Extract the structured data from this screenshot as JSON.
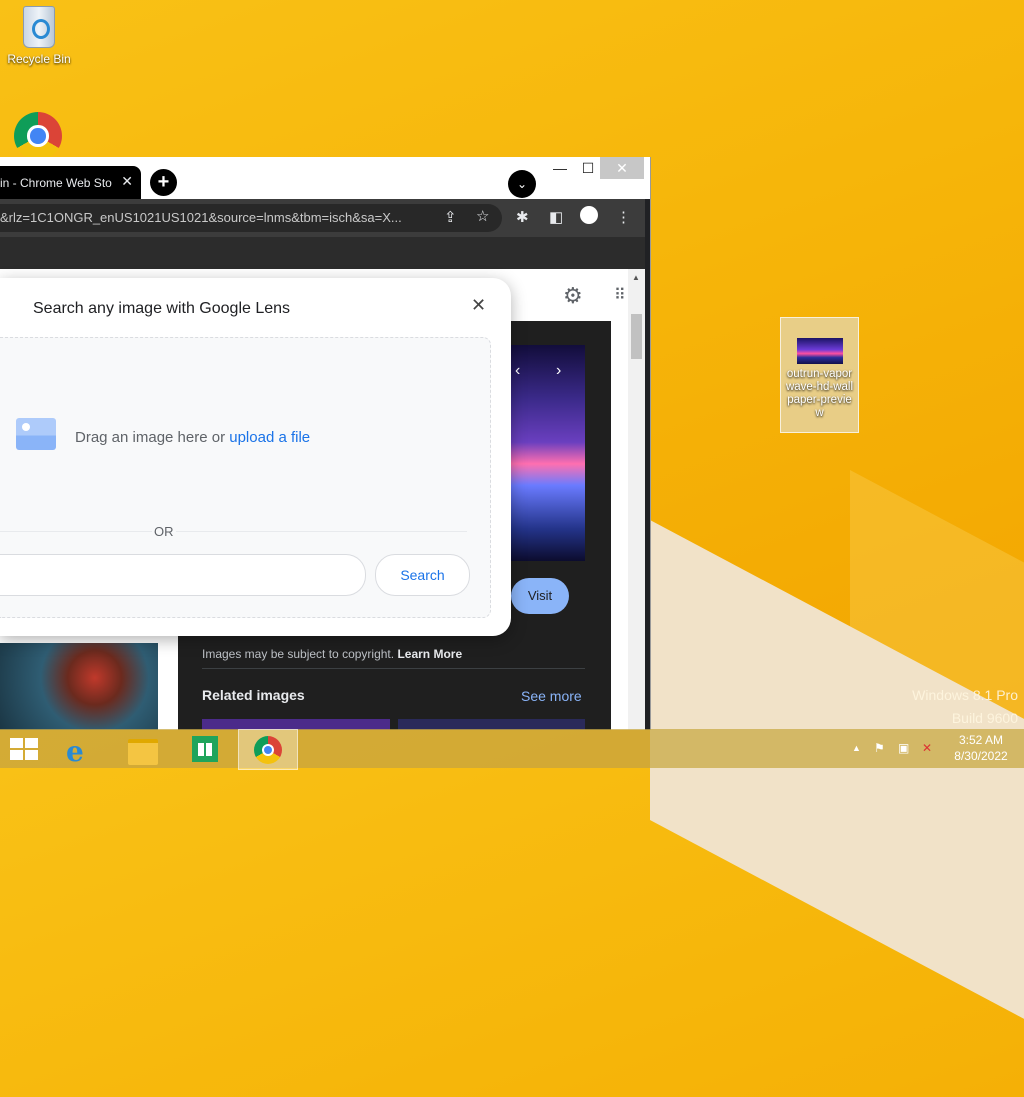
{
  "desktop": {
    "recycle_bin_label": "Recycle Bin",
    "file_label": "outrun-vaporwave-hd-wallpaper-preview",
    "watermark_line1": "Windows 8.1 Pro",
    "watermark_line2": "Build 9600"
  },
  "browser": {
    "tab_title": "in - Chrome Web Sto",
    "tab_close": "✕",
    "new_tab": "+",
    "tab_search": "⌄",
    "minimize": "—",
    "maximize": "☐",
    "close": "✕",
    "url": "&rlz=1C1ONGR_enUS1021US1021&source=lnms&tbm=isch&sa=X...",
    "share_icon": "⇪",
    "star_icon": "☆",
    "extensions_icon": "✱",
    "sidepanel_icon": "◧",
    "menu_icon": "⋮"
  },
  "page": {
    "settings_icon": "⚙",
    "apps_icon": "⠿",
    "prev_arrow": "‹",
    "next_arrow": "›",
    "visit_label": "Visit",
    "copyright_text": "Images may be subject to copyright.",
    "learn_more": "Learn More",
    "related_images": "Related images",
    "see_more": "See more"
  },
  "lens_dialog": {
    "title": "Search any image with Google Lens",
    "close": "✕",
    "drag_text": "Drag an image here or ",
    "upload_link": "upload a file",
    "or_text": "OR",
    "search_button": "Search"
  },
  "taskbar": {
    "time": "3:52 AM",
    "date": "8/30/2022",
    "tray_up": "▲",
    "tray_flag": "⚑",
    "tray_network": "▣",
    "tray_volume": "✕"
  }
}
